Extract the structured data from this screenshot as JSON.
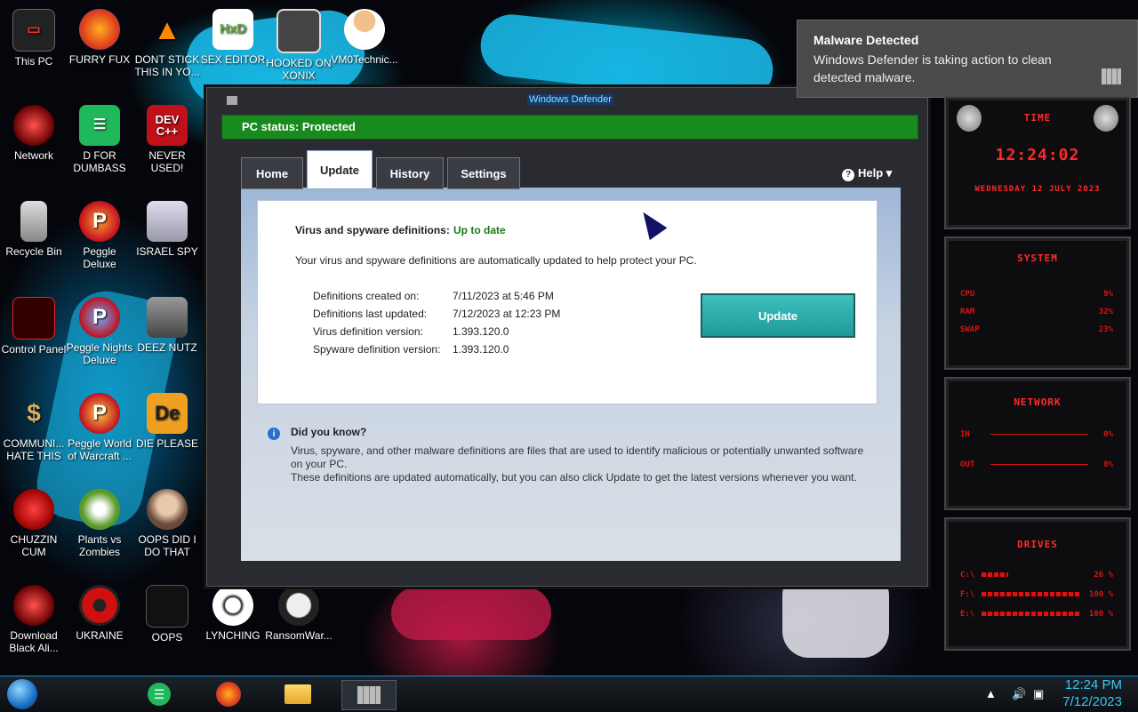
{
  "desktop": {
    "icons": [
      {
        "label": "This PC"
      },
      {
        "label": "FURRY FUX"
      },
      {
        "label": "DONT STICK THIS IN YO..."
      },
      {
        "label": "SEX EDITOR"
      },
      {
        "label": "HOOKED ON XONIX"
      },
      {
        "label": "VM0Technic..."
      },
      {
        "label": "Network"
      },
      {
        "label": "D FOR DUMBASS"
      },
      {
        "label": "NEVER USED!"
      },
      {
        "label": "Recycle Bin"
      },
      {
        "label": "Peggle Deluxe"
      },
      {
        "label": "ISRAEL SPY"
      },
      {
        "label": "Control Panel"
      },
      {
        "label": "Peggle Nights Deluxe"
      },
      {
        "label": "DEEZ NUTZ"
      },
      {
        "label": "COMMUNI... HATE THIS"
      },
      {
        "label": "Peggle World of Warcraft ..."
      },
      {
        "label": "DIE PLEASE"
      },
      {
        "label": "CHUZZIN CUM"
      },
      {
        "label": "Plants vs Zombies"
      },
      {
        "label": "OOPS DID I DO THAT"
      },
      {
        "label": "Download Black Ali..."
      },
      {
        "label": "UKRAINE"
      },
      {
        "label": "OOPS"
      },
      {
        "label": "LYNCHING"
      },
      {
        "label": "RansomWar..."
      }
    ],
    "dev_icon_text": "DEV C++",
    "die_icon_text": "De"
  },
  "notification": {
    "title": "Malware Detected",
    "body": "Windows Defender is taking action to clean detected malware."
  },
  "defender": {
    "window_title": "Windows Defender",
    "status": "PC status: Protected",
    "tabs": [
      {
        "label": "Home"
      },
      {
        "label": "Update"
      },
      {
        "label": "History"
      },
      {
        "label": "Settings"
      }
    ],
    "active_tab": "Update",
    "help_label": "Help ▾",
    "definitions_label": "Virus and spyware definitions:",
    "definitions_status": "Up to date",
    "definitions_desc": "Your virus and spyware definitions are automatically updated to help protect your PC.",
    "info": [
      {
        "key": "Definitions created on:",
        "value": "7/11/2023 at 5:46 PM"
      },
      {
        "key": "Definitions last updated:",
        "value": "7/12/2023 at 12:23 PM"
      },
      {
        "key": "Virus definition version:",
        "value": "1.393.120.0"
      },
      {
        "key": "Spyware definition version:",
        "value": "1.393.120.0"
      }
    ],
    "update_button": "Update",
    "did_you_know_title": "Did you know?",
    "did_you_know_text1": "Virus, spyware, and other malware definitions are files that are used to identify malicious or potentially unwanted software on your PC.",
    "did_you_know_text2": "These definitions are updated automatically, but you can also click Update to get the latest versions whenever you want."
  },
  "rainmeter": {
    "time_head": "TIME",
    "time": "12:24:02",
    "date": "WEDNESDAY 12 JULY 2023",
    "system_head": "SYSTEM",
    "cpu_label": "CPU",
    "cpu_value": "9%",
    "ram_label": "RAM",
    "ram_value": "32%",
    "swap_label": "SWAP",
    "swap_value": "23%",
    "network_head": "NETWORK",
    "in_label": "IN",
    "in_value": "0%",
    "out_label": "OUT",
    "out_value": "0%",
    "drives_head": "DRIVES",
    "drives": [
      {
        "label": "C:\\",
        "value": "26 %"
      },
      {
        "label": "F:\\",
        "value": "100 %"
      },
      {
        "label": "E:\\",
        "value": "100 %"
      }
    ]
  },
  "taskbar": {
    "time": "12:24 PM",
    "date": "7/12/2023"
  },
  "colors": {
    "status_green": "#198a1e",
    "accent_cyan": "#3ac6f0",
    "rm_red": "#e01010"
  }
}
